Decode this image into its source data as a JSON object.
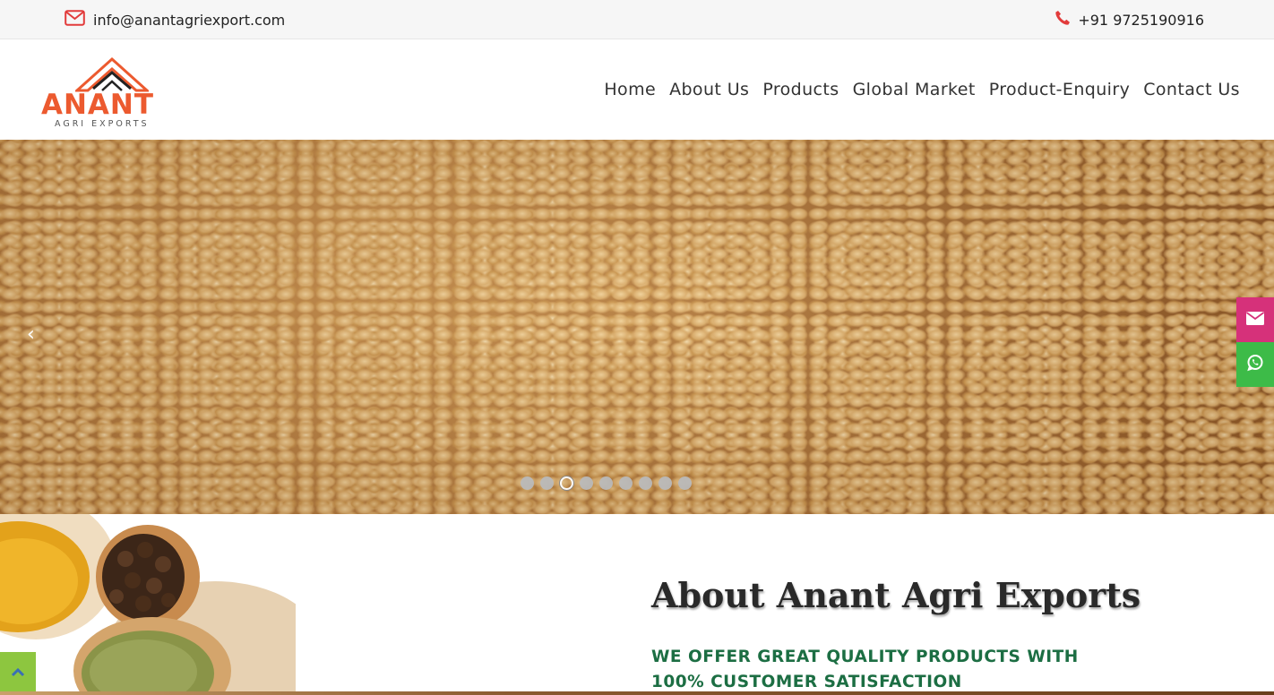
{
  "topbar": {
    "email": "info@anantagriexport.com",
    "phone": "+91 9725190916",
    "email_icon": "envelope-icon",
    "phone_icon": "phone-icon"
  },
  "logo": {
    "brand": "ANANT",
    "tagline": "AGRI EXPORTS"
  },
  "nav": {
    "items": [
      "Home",
      "About Us",
      "Products",
      "Global Market",
      "Product-Enquiry",
      "Contact Us"
    ]
  },
  "slider": {
    "prev_icon": "chevron-left-icon",
    "next_icon": "chevron-right-icon",
    "prev_glyph": "‹",
    "next_glyph": "›",
    "slide_count": 9,
    "active_slide": 3
  },
  "side_buttons": {
    "email_icon": "envelope-icon",
    "whatsapp_icon": "whatsapp-icon"
  },
  "about": {
    "title": "About Anant Agri Exports",
    "subtitle": "WE OFFER GREAT QUALITY PRODUCTS WITH 100% CUSTOMER SATISFACTION"
  },
  "colors": {
    "accent_orange": "#ec5a2f",
    "pink_button": "#d6317a",
    "whatsapp_green": "#3dbb48",
    "subtitle_green": "#1c6e43",
    "back_to_top": "#8dc63f"
  }
}
